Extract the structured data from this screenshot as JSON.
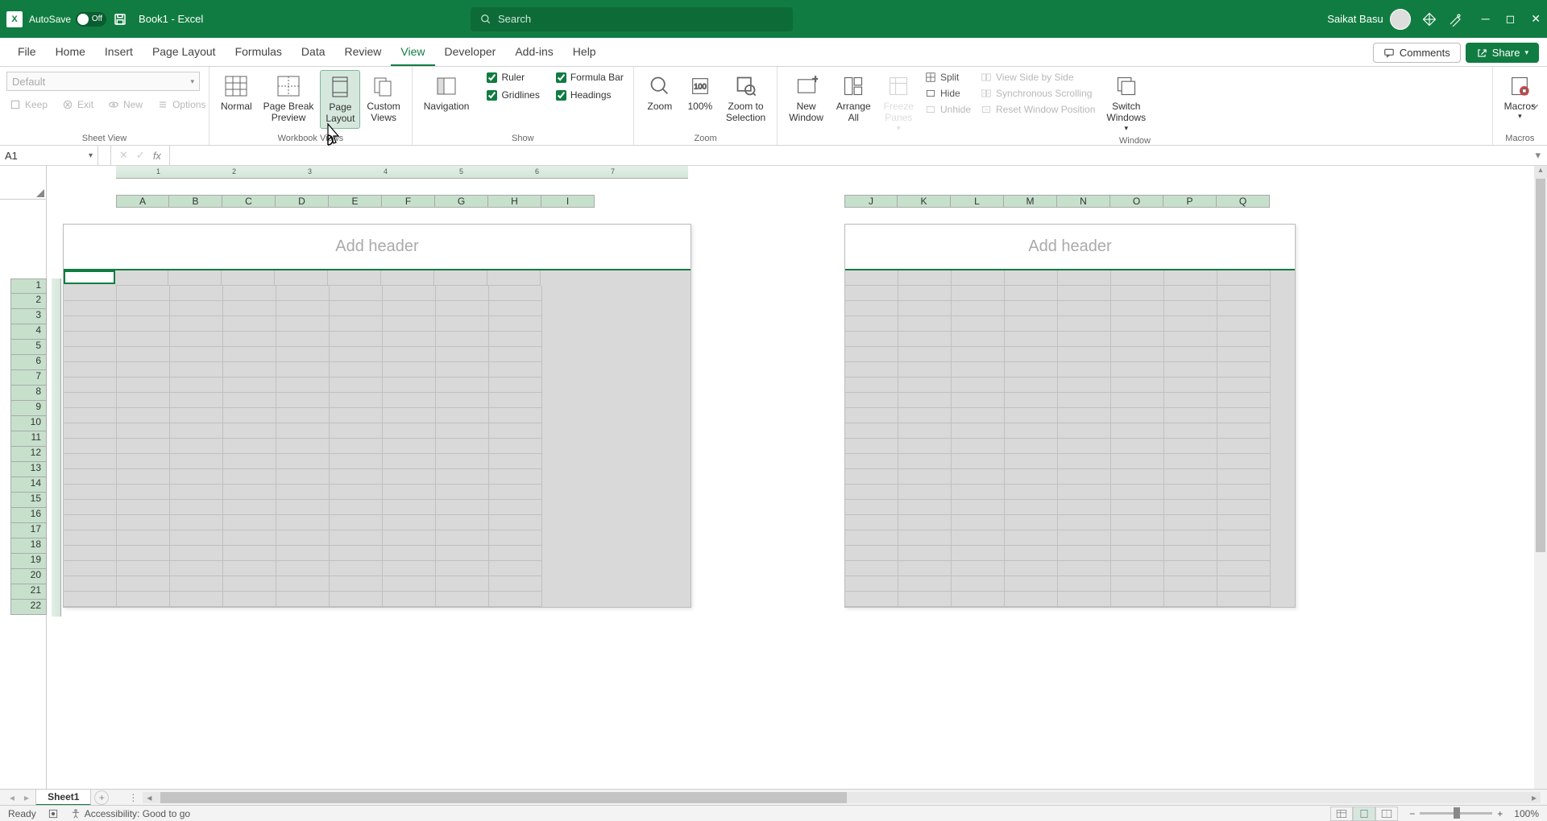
{
  "titlebar": {
    "autosave_label": "AutoSave",
    "autosave_state": "Off",
    "doc_title": "Book1  -  Excel",
    "search_placeholder": "Search",
    "user_name": "Saikat Basu"
  },
  "tabs": {
    "items": [
      "File",
      "Home",
      "Insert",
      "Page Layout",
      "Formulas",
      "Data",
      "Review",
      "View",
      "Developer",
      "Add-ins",
      "Help"
    ],
    "active": "View",
    "comments": "Comments",
    "share": "Share"
  },
  "ribbon": {
    "sheet_view": {
      "select_placeholder": "Default",
      "keep": "Keep",
      "exit": "Exit",
      "new": "New",
      "options": "Options",
      "label": "Sheet View"
    },
    "workbook_views": {
      "normal": "Normal",
      "page_break": "Page Break\nPreview",
      "page_layout": "Page\nLayout",
      "custom": "Custom\nViews",
      "label": "Workbook Views"
    },
    "navigation": "Navigation",
    "show": {
      "ruler": "Ruler",
      "formula_bar": "Formula Bar",
      "gridlines": "Gridlines",
      "headings": "Headings",
      "label": "Show"
    },
    "zoom": {
      "zoom": "Zoom",
      "hundred": "100%",
      "to_selection": "Zoom to\nSelection",
      "label": "Zoom"
    },
    "window": {
      "new_window": "New\nWindow",
      "arrange_all": "Arrange\nAll",
      "freeze": "Freeze\nPanes",
      "split": "Split",
      "hide": "Hide",
      "unhide": "Unhide",
      "side_by_side": "View Side by Side",
      "sync_scroll": "Synchronous Scrolling",
      "reset_pos": "Reset Window Position",
      "switch": "Switch\nWindows",
      "macros": "Macros",
      "label": "Window",
      "macros_label": "Macros"
    }
  },
  "formula_bar": {
    "name_box": "A1"
  },
  "columns_page1": [
    "A",
    "B",
    "C",
    "D",
    "E",
    "F",
    "G",
    "H",
    "I"
  ],
  "columns_page2": [
    "J",
    "K",
    "L",
    "M",
    "N",
    "O",
    "P",
    "Q"
  ],
  "rows": [
    "1",
    "2",
    "3",
    "4",
    "5",
    "6",
    "7",
    "8",
    "9",
    "10",
    "11",
    "12",
    "13",
    "14",
    "15",
    "16",
    "17",
    "18",
    "19",
    "20",
    "21",
    "22"
  ],
  "ruler_numbers": [
    "1",
    "2",
    "3",
    "4",
    "5",
    "6",
    "7"
  ],
  "page": {
    "header_placeholder": "Add header"
  },
  "sheet_tabs": {
    "active": "Sheet1"
  },
  "status": {
    "ready": "Ready",
    "accessibility": "Accessibility: Good to go",
    "zoom": "100%"
  }
}
